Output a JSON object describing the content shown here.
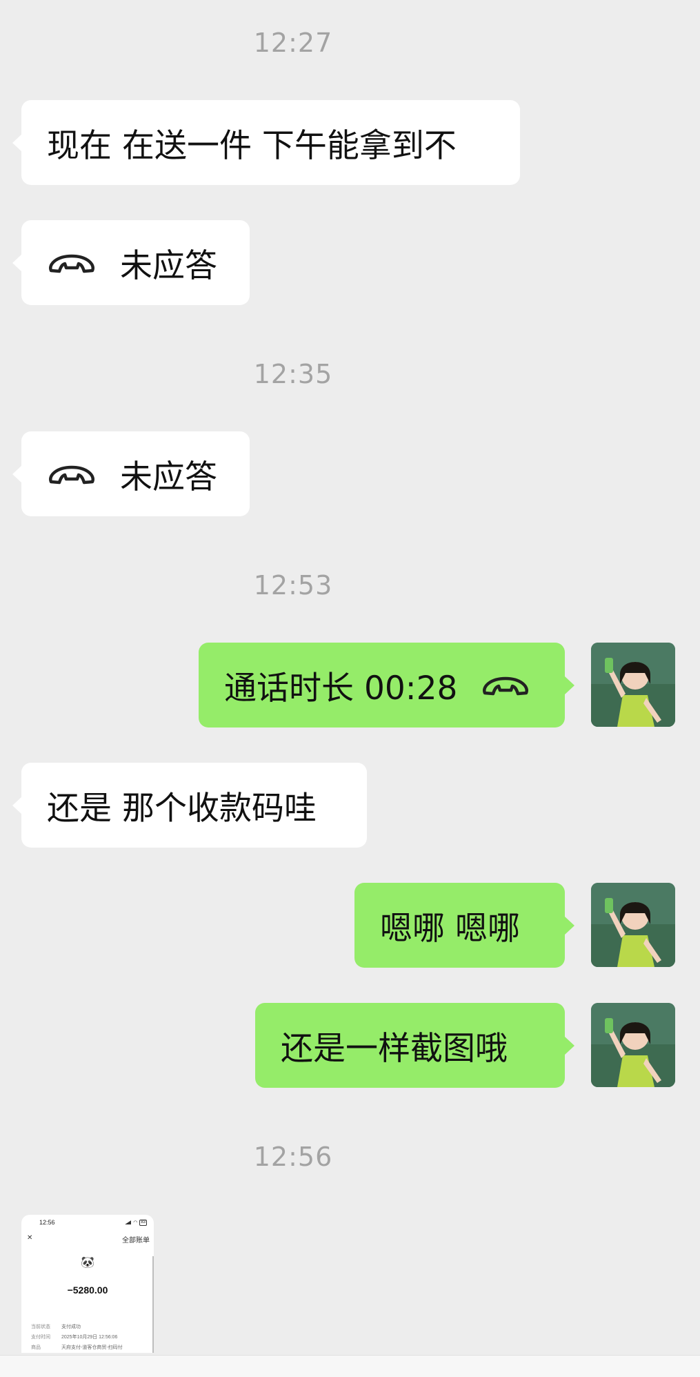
{
  "times": [
    "12:27",
    "12:35",
    "12:53",
    "12:56"
  ],
  "messages": {
    "m1": "现在 在送一件 下午能拿到不",
    "m2_label": "未应答",
    "m3_label": "未应答",
    "m4_label": "通话时长 00:28",
    "m5": "还是 那个收款码哇",
    "m6": "嗯哪 嗯哪",
    "m7": "还是一样截图哦"
  },
  "icons": {
    "call": "phone-handset-icon",
    "avatar": "user-avatar",
    "close": "close-icon",
    "signal": "signal-icon",
    "wifi": "wifi-icon",
    "battery": "battery-icon"
  },
  "colors": {
    "background": "#ededed",
    "incoming_bubble": "#ffffff",
    "outgoing_bubble": "#95ec69",
    "timestamp": "#a3a3a3"
  },
  "screenshot": {
    "status_time": "12:56",
    "battery": "83",
    "header_right": "全部账单",
    "logo": "🐼",
    "amount": "−5280.00",
    "rows": [
      {
        "k": "当前状态",
        "v": "支付成功"
      },
      {
        "k": "支付时间",
        "v": "2025年10月29日 12:56:06"
      },
      {
        "k": "商品",
        "v": "天府支付-道客仓商贸-扫码付"
      }
    ]
  }
}
